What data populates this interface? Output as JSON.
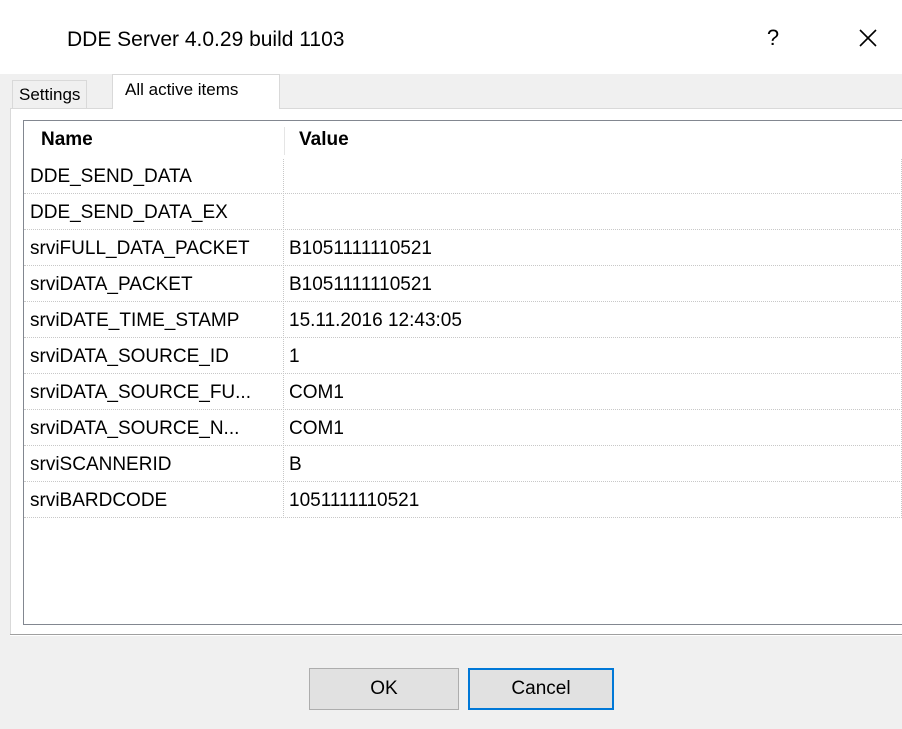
{
  "window": {
    "title": "DDE Server 4.0.29 build 1103",
    "help_label": "?",
    "close_icon": "close-icon"
  },
  "tabs": [
    {
      "label": "Settings",
      "active": false
    },
    {
      "label": "All active items",
      "active": true
    }
  ],
  "list": {
    "columns": [
      "Name",
      "Value"
    ],
    "rows": [
      {
        "name": "DDE_SEND_DATA",
        "value": ""
      },
      {
        "name": "DDE_SEND_DATA_EX",
        "value": ""
      },
      {
        "name": "srviFULL_DATA_PACKET",
        "value": "B1051111110521"
      },
      {
        "name": "srviDATA_PACKET",
        "value": "B1051111110521"
      },
      {
        "name": "srviDATE_TIME_STAMP",
        "value": "15.11.2016 12:43:05"
      },
      {
        "name": "srviDATA_SOURCE_ID",
        "value": "1"
      },
      {
        "name": "srviDATA_SOURCE_FU...",
        "value": "COM1"
      },
      {
        "name": "srviDATA_SOURCE_N...",
        "value": "COM1"
      },
      {
        "name": "srviSCANNERID",
        "value": "B"
      },
      {
        "name": "srviBARDCODE",
        "value": "1051111110521"
      }
    ]
  },
  "buttons": {
    "ok_label": "OK",
    "cancel_label": "Cancel"
  },
  "colors": {
    "focus_border": "#0078d7",
    "button_face": "#e1e1e1",
    "dialog_background": "#f0f0f0"
  }
}
